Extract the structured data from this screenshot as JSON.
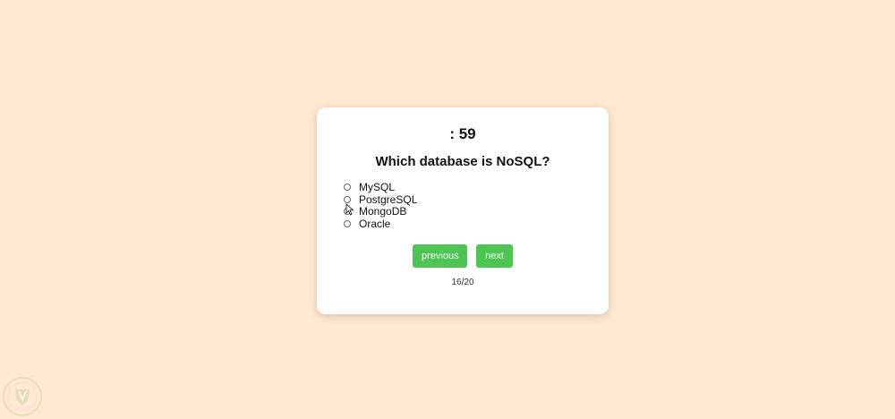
{
  "quiz": {
    "timer": ": 59",
    "question": "Which database is NoSQL?",
    "options": [
      {
        "label": "MySQL"
      },
      {
        "label": "PostgreSQL"
      },
      {
        "label": "MongoDB"
      },
      {
        "label": "Oracle"
      }
    ],
    "buttons": {
      "previous_label": "previous",
      "next_label": "next"
    },
    "counter": "16/20"
  },
  "colors": {
    "background": "#ffe9d2",
    "card": "#ffffff",
    "button": "#4cc552"
  },
  "icons": {
    "cursor": "mouse-pointer-icon",
    "watermark": "shield-logo-icon"
  }
}
